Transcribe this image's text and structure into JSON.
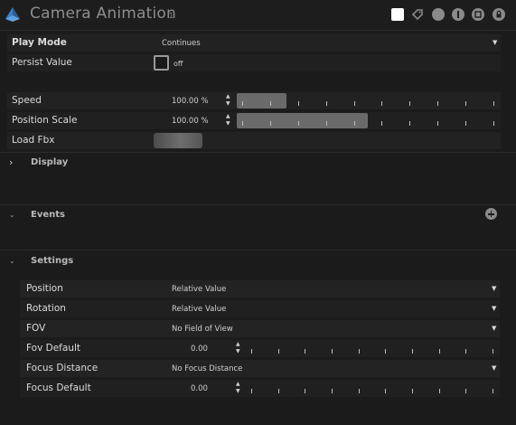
{
  "header": {
    "title": "Camera Animation",
    "badge": "1",
    "icons": [
      "color-swatch-icon",
      "tag-icon",
      "circle-icon",
      "info-icon",
      "record-icon",
      "lock-icon"
    ]
  },
  "properties": {
    "play_mode": {
      "label": "Play Mode",
      "value": "Continues"
    },
    "persist_value": {
      "label": "Persist Value",
      "state": "off"
    },
    "speed": {
      "label": "Speed",
      "value": "100.00 %",
      "fill_fraction": 0.19
    },
    "position_scale": {
      "label": "Position Scale",
      "value": "100.00 %",
      "fill_fraction": 0.5
    },
    "load_fbx": {
      "label": "Load Fbx"
    }
  },
  "sections": {
    "display": {
      "title": "Display"
    },
    "events": {
      "title": "Events"
    },
    "settings": {
      "title": "Settings"
    }
  },
  "settings": {
    "position": {
      "label": "Position",
      "value": "Relative Value"
    },
    "rotation": {
      "label": "Rotation",
      "value": "Relative Value"
    },
    "fov": {
      "label": "FOV",
      "value": "No Field of View"
    },
    "fov_default": {
      "label": "Fov Default",
      "value": "0.00"
    },
    "focus_distance": {
      "label": "Focus Distance",
      "value": "No Focus Distance"
    },
    "focus_default": {
      "label": "Focus Default",
      "value": "0.00"
    }
  },
  "colors": {
    "background": "#1b1b1b",
    "row": "#222222",
    "slider_fill": "#6a6a6a",
    "swatch": "#ffffff"
  }
}
